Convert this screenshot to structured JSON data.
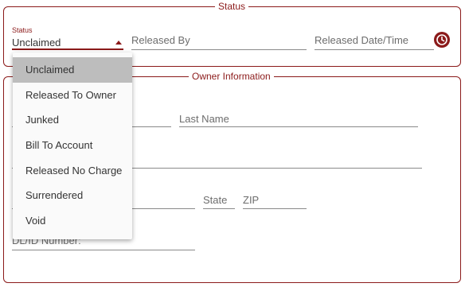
{
  "status_section": {
    "legend": "Status",
    "status_field": {
      "label": "Status",
      "value": "Unclaimed"
    },
    "released_by_placeholder": "Released By",
    "released_datetime_placeholder": "Released Date/Time"
  },
  "owner_section": {
    "legend": "Owner Information",
    "last_name_placeholder": "Last Name",
    "state_placeholder": "State",
    "zip_placeholder": "ZIP",
    "dl_id_placeholder": "DL/ID Number:"
  },
  "status_menu": {
    "options": [
      "Unclaimed",
      "Released To Owner",
      "Junked",
      "Bill To Account",
      "Released No Charge",
      "Surrendered",
      "Void"
    ],
    "selected_index": 0
  },
  "colors": {
    "accent": "#8b1a1a",
    "menu_selected": "#bdbdbd",
    "menu_bg": "#fafafa"
  },
  "icons": {
    "datetime_picker": "clock-icon",
    "status_dropdown": "caret-up-icon"
  }
}
